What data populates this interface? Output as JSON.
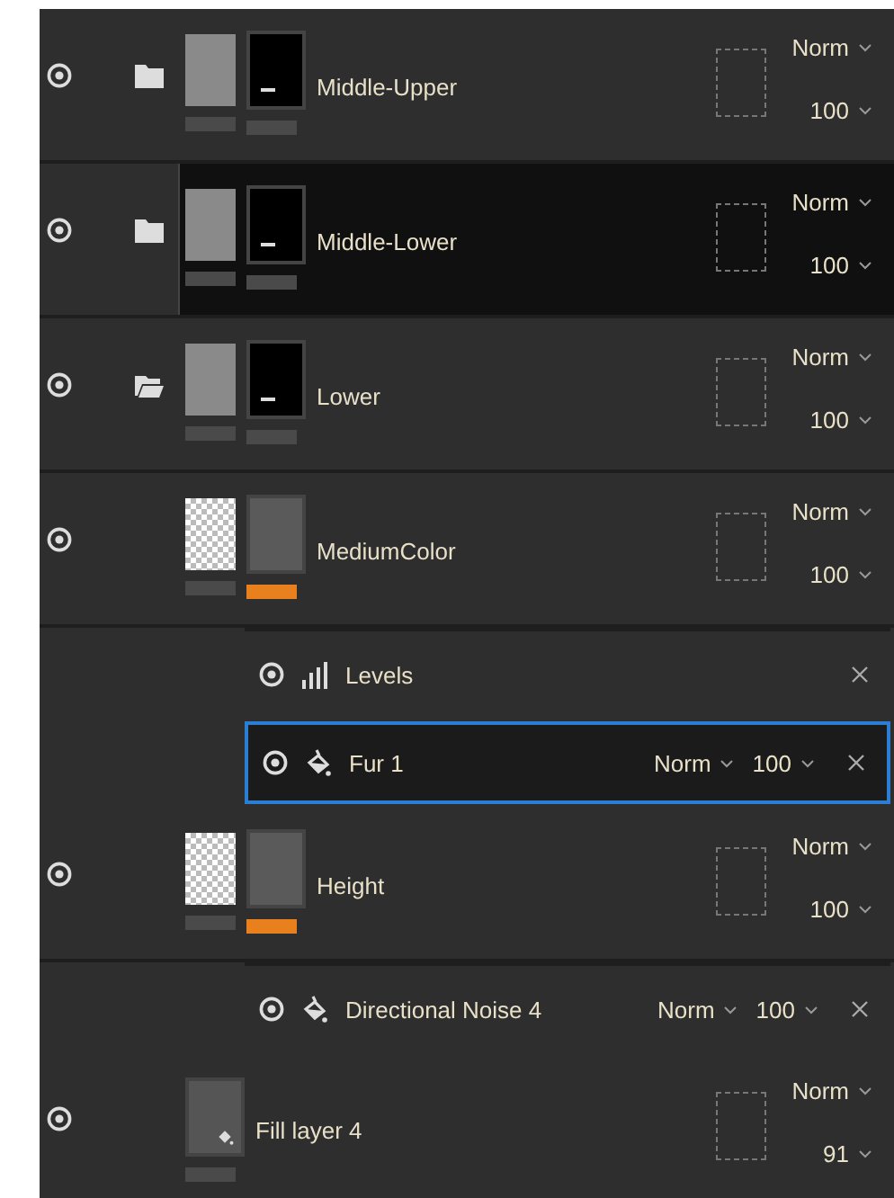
{
  "layers": [
    {
      "kind": "folder",
      "name": "Middle-Upper",
      "expanded": false,
      "selected": false,
      "mask_active": false,
      "blend": "Norm",
      "opacity": "100"
    },
    {
      "kind": "folder",
      "name": "Middle-Lower",
      "expanded": false,
      "selected": true,
      "mask_active": false,
      "blend": "Norm",
      "opacity": "100"
    },
    {
      "kind": "folder",
      "name": "Lower",
      "expanded": true,
      "selected": false,
      "mask_active": false,
      "blend": "Norm",
      "opacity": "100",
      "children": [
        {
          "kind": "layer",
          "name": "MediumColor",
          "selected": false,
          "mask_active": true,
          "blend": "Norm",
          "opacity": "100",
          "effects": [
            {
              "kind": "levels",
              "name": "Levels",
              "selected": false
            },
            {
              "kind": "fill",
              "name": "Fur 1",
              "selected": true,
              "blend": "Norm",
              "opacity": "100"
            }
          ]
        },
        {
          "kind": "layer",
          "name": "Height",
          "selected": false,
          "mask_active": true,
          "blend": "Norm",
          "opacity": "100",
          "effects": [
            {
              "kind": "fill",
              "name": "Directional Noise 4",
              "selected": false,
              "blend": "Norm",
              "opacity": "100"
            }
          ]
        },
        {
          "kind": "fill",
          "name": "Fill layer 4",
          "selected": false,
          "blend": "Norm",
          "opacity": "91"
        }
      ]
    }
  ]
}
